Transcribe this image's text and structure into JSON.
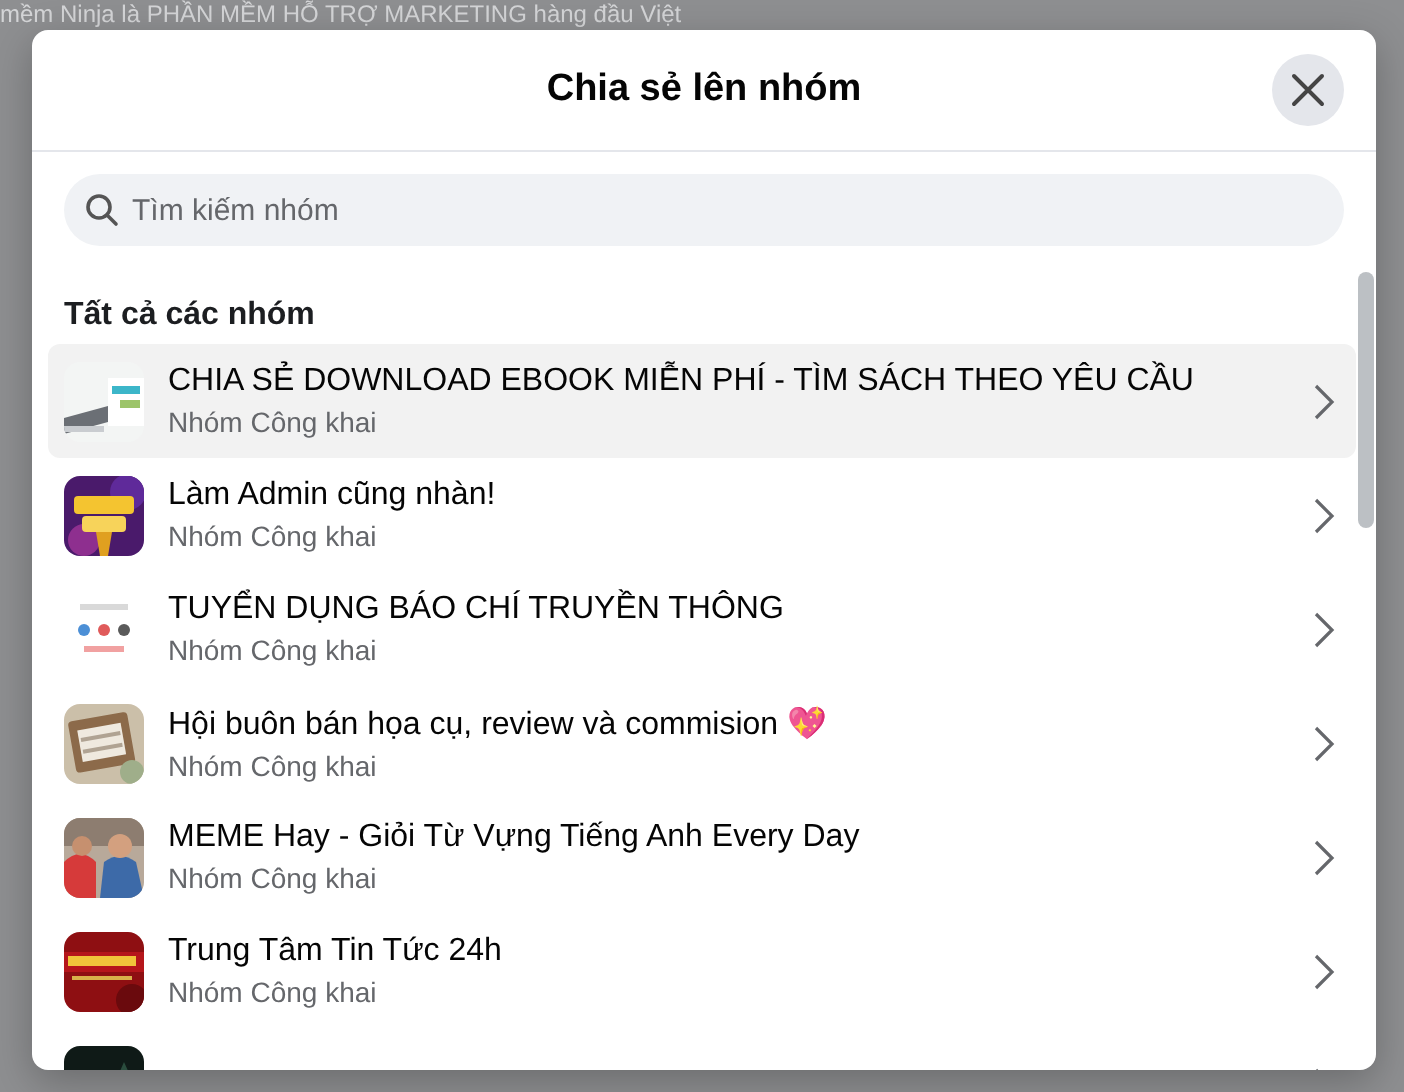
{
  "background_text": "mềm Ninja là PHẦN MỀM HỖ TRỢ MARKETING hàng đầu Việt",
  "dialog": {
    "title": "Chia sẻ lên nhóm",
    "search": {
      "placeholder": "Tìm kiếm nhóm"
    },
    "section_title": "Tất cả các nhóm",
    "groups": [
      {
        "name": "CHIA SẺ DOWNLOAD EBOOK MIỄN PHÍ - TÌM SÁCH THEO YÊU CẦU",
        "privacy": "Nhóm Công khai",
        "selected": true
      },
      {
        "name": "Làm Admin cũng nhàn!",
        "privacy": "Nhóm Công khai",
        "selected": false
      },
      {
        "name": "TUYỂN DỤNG BÁO CHÍ TRUYỀN THÔNG",
        "privacy": "Nhóm Công khai",
        "selected": false
      },
      {
        "name": "Hội buôn bán họa cụ, review và commision 💖",
        "privacy": "Nhóm Công khai",
        "selected": false
      },
      {
        "name": "MEME Hay - Giỏi Từ Vựng Tiếng Anh Every Day",
        "privacy": "Nhóm Công khai",
        "selected": false
      },
      {
        "name": "Trung Tâm Tin Tức 24h",
        "privacy": "Nhóm Công khai",
        "selected": false
      },
      {
        "selected": false
      }
    ]
  }
}
